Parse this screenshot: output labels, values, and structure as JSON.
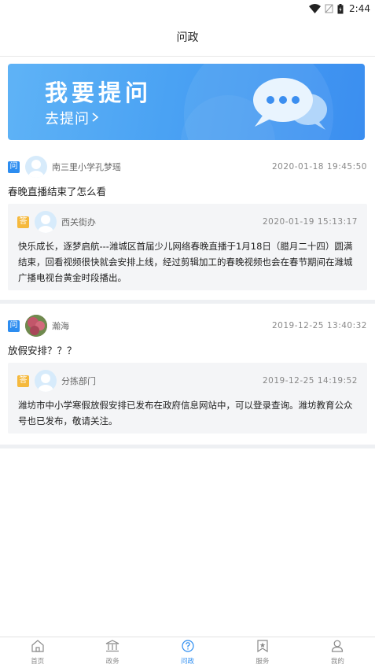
{
  "status_bar": {
    "time": "2:44",
    "icons": [
      "wifi-icon",
      "no-signal-icon",
      "battery-icon"
    ]
  },
  "header": {
    "title": "问政"
  },
  "banner": {
    "title": "我要提问",
    "subtitle": "去提问",
    "icon": "chat-bubbles-icon"
  },
  "questions": [
    {
      "tag": "问",
      "asker": "南三里小学孔梦瑶",
      "time": "2020-01-18  19:45:50",
      "text": "春晚直播结束了怎么看",
      "answer": {
        "tag": "答",
        "responder": "西关街办",
        "time": "2020-01-19  15:13:17",
        "text": "快乐成长，逐梦启航---潍城区首届少儿网络春晚直播于1月18日（腊月二十四）圆满结束，回看视频很快就会安排上线，经过剪辑加工的春晚视频也会在春节期间在潍城广播电视台黄金时段播出。"
      }
    },
    {
      "tag": "问",
      "asker": "瀚海",
      "time": "2019-12-25  13:40:32",
      "text": "放假安排？？？",
      "answer": {
        "tag": "答",
        "responder": "分拣部门",
        "time": "2019-12-25  14:19:52",
        "text": "潍坊市中小学寒假放假安排已发布在政府信息网站中，可以登录查询。潍坊教育公众号也已发布，敬请关注。"
      }
    }
  ],
  "bottom_nav": [
    {
      "label": "首页",
      "icon": "home-icon"
    },
    {
      "label": "政务",
      "icon": "government-building-icon"
    },
    {
      "label": "问政",
      "icon": "question-circle-icon"
    },
    {
      "label": "服务",
      "icon": "bookmark-star-icon"
    },
    {
      "label": "我的",
      "icon": "user-icon"
    }
  ],
  "colors": {
    "accent": "#2d8df0",
    "answer_tag": "#f5b93d",
    "answer_bg": "#f4f5f7"
  }
}
